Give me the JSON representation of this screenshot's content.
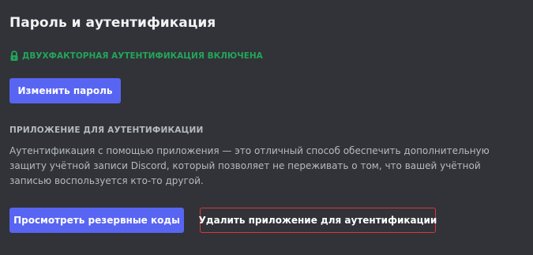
{
  "header": {
    "title": "Пароль и аутентификация"
  },
  "status": {
    "icon": "lock-icon",
    "text": "ДВУХФАКТОРНАЯ АУТЕНТИФИКАЦИЯ ВКЛЮЧЕНА",
    "color": "#23a55a"
  },
  "password": {
    "change_label": "Изменить пароль"
  },
  "auth_app": {
    "heading": "ПРИЛОЖЕНИЕ ДЛЯ АУТЕНТИФИКАЦИИ",
    "description": "Аутентификация с помощью приложения — это отличный способ обеспечить дополнительную защиту учётной записи Discord, который позволяет не переживать о том, что вашей учётной записью воспользуется кто-то другой.",
    "view_backup_label": "Просмотреть резервные коды",
    "remove_app_label": "Удалить приложение для аутентификации"
  },
  "colors": {
    "background": "#313338",
    "accent": "#5865f2",
    "danger": "#da373c"
  }
}
